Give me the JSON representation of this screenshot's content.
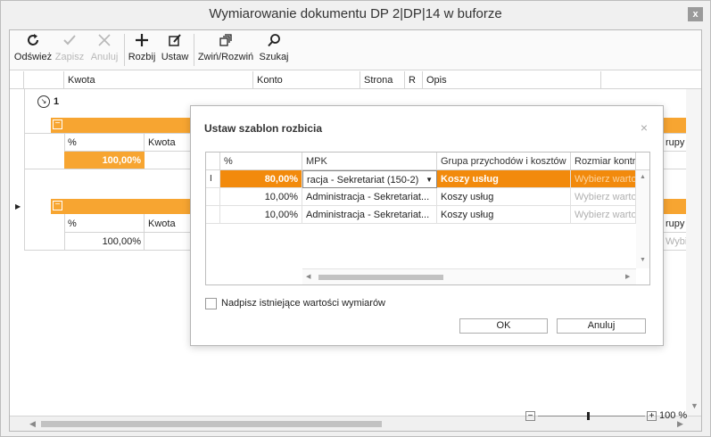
{
  "window": {
    "title": "Wymiarowanie dokumentu DP 2|DP|14 w buforze",
    "close_label": "x"
  },
  "toolbar": {
    "refresh": "Odśwież",
    "save": "Zapisz",
    "cancel": "Anuluj",
    "split": "Rozbij",
    "set": "Ustaw",
    "collapse_expand": "Zwiń/Rozwiń",
    "search": "Szukaj"
  },
  "grid": {
    "columns": [
      "Kwota",
      "Konto",
      "Strona",
      "R",
      "Opis"
    ],
    "group_label": "1",
    "sub_headers": [
      "%",
      "Kwota"
    ],
    "row1_percent": "100,00%",
    "row2_percent": "100,00%",
    "right_header_fragment": "rupy",
    "right_value_fragment": "Wybie",
    "right_value_fragment2": "Wybie"
  },
  "dialog": {
    "title": "Ustaw szablon rozbicia",
    "close_label": "×",
    "columns": [
      "%",
      "MPK",
      "Grupa przychodów i kosztów",
      "Rozmiar kontr"
    ],
    "rows": [
      {
        "percent": "80,00%",
        "mpk": "racja - Sekretariat (150-2)",
        "group": "Koszy usług",
        "size": "Wybierz wartość"
      },
      {
        "percent": "10,00%",
        "mpk": "Administracja - Sekretariat...",
        "group": "Koszy usług",
        "size": "Wybierz wartość"
      },
      {
        "percent": "10,00%",
        "mpk": "Administracja - Sekretariat...",
        "group": "Koszy usług",
        "size": "Wybierz wartość"
      }
    ],
    "overwrite_label": "Nadpisz istniejące wartości wymiarów",
    "ok_label": "OK",
    "cancel_label": "Anuluj"
  },
  "zoom": {
    "value": "100 %",
    "minus": "−",
    "plus": "+"
  },
  "colors": {
    "accent_orange": "#f7a531",
    "accent_orange_dark": "#f28a0c"
  },
  "icons": {
    "refresh": "refresh-icon",
    "save": "check-icon",
    "cancel": "x-icon",
    "split": "plus-icon",
    "set": "edit-icon",
    "collapse": "windows-icon",
    "search": "search-icon"
  }
}
